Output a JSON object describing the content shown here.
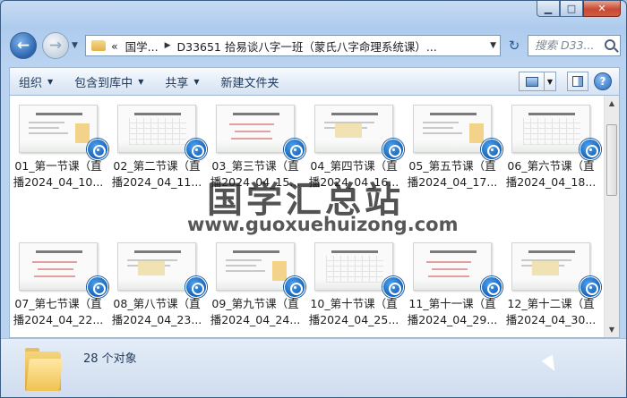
{
  "window": {
    "caption_buttons": {
      "minimize": "▁",
      "maximize": "□",
      "close": "✕"
    }
  },
  "address_bar": {
    "overflow": "«",
    "crumbs": [
      "国学...",
      "D33651 拾易谈八字一班（蒙氏八字命理系统课）..."
    ],
    "history_dropdown": "▼",
    "refresh_icon": "↻"
  },
  "search": {
    "placeholder": "搜索 D33..."
  },
  "toolbar": {
    "organize": "组织",
    "include_in_library": "包含到库中",
    "share": "共享",
    "new_folder": "新建文件夹",
    "help": "?"
  },
  "files": [
    {
      "line1": "01_第一节课（直",
      "line2": "播2024_04_10..."
    },
    {
      "line1": "02_第二节课（直",
      "line2": "播2024_04_11..."
    },
    {
      "line1": "03_第三节课（直",
      "line2": "播2024_04_15..."
    },
    {
      "line1": "04_第四节课（直",
      "line2": "播2024_04_16..."
    },
    {
      "line1": "05_第五节课（直",
      "line2": "播2024_04_17..."
    },
    {
      "line1": "06_第六节课（直",
      "line2": "播2024_04_18..."
    },
    {
      "line1": "07_第七节课（直",
      "line2": "播2024_04_22..."
    },
    {
      "line1": "08_第八节课（直",
      "line2": "播2024_04_23..."
    },
    {
      "line1": "09_第九节课（直",
      "line2": "播2024_04_24..."
    },
    {
      "line1": "10_第十节课（直",
      "line2": "播2024_04_25..."
    },
    {
      "line1": "11_第十一课（直",
      "line2": "播2024_04_29..."
    },
    {
      "line1": "12_第十二课（直",
      "line2": "播2024_04_30..."
    }
  ],
  "watermark": {
    "title": "国学汇总站",
    "url": "www.guoxuehuizong.com"
  },
  "status": {
    "object_count": "28 个对象"
  }
}
